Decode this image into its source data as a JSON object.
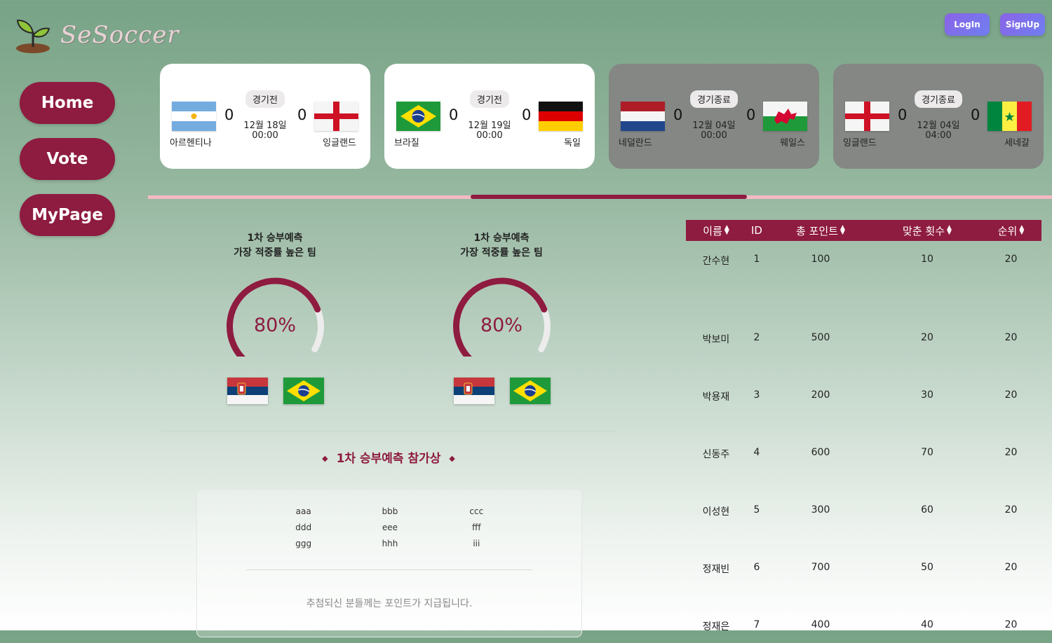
{
  "header": {
    "logo_text": "SeSoccer",
    "login_label": "LogIn",
    "signup_label": "SignUp"
  },
  "nav": {
    "home": "Home",
    "vote": "Vote",
    "mypage": "MyPage"
  },
  "matches": [
    {
      "status": "경기전",
      "home_team": "아르헨티나",
      "away_team": "잉글랜드",
      "home_score": "0",
      "away_score": "0",
      "date": "12월 18일",
      "time": "00:00",
      "home_flag": "argentina-flag",
      "away_flag": "england-flag"
    },
    {
      "status": "경기전",
      "home_team": "브라질",
      "away_team": "독일",
      "home_score": "0",
      "away_score": "0",
      "date": "12월 19일",
      "time": "00:00",
      "home_flag": "brazil-flag",
      "away_flag": "germany-flag"
    },
    {
      "status": "경기종료",
      "home_team": "네덜란드",
      "away_team": "웨일스",
      "home_score": "0",
      "away_score": "0",
      "date": "12월 04일",
      "time": "00:00",
      "home_flag": "netherlands-flag",
      "away_flag": "wales-flag"
    },
    {
      "status": "경기종료",
      "home_team": "잉글랜드",
      "away_team": "세네갈",
      "home_score": "0",
      "away_score": "0",
      "date": "12월 04일",
      "time": "04:00",
      "home_flag": "england-flag",
      "away_flag": "senegal-flag"
    }
  ],
  "predictions": [
    {
      "title_line1": "1차 승부예측",
      "title_line2": "가장 적중률 높은 팀",
      "percent_text": "80%",
      "percent_value": 0.8,
      "flags": [
        "serbia-flag",
        "brazil-flag"
      ]
    },
    {
      "title_line1": "1차 승부예측",
      "title_line2": "가장 적중률 높은 팀",
      "percent_text": "80%",
      "percent_value": 0.8,
      "flags": [
        "serbia-flag",
        "brazil-flag"
      ]
    }
  ],
  "winners": {
    "title": "1차 승부예측 참가상",
    "names": [
      "aaa",
      "bbb",
      "ccc",
      "ddd",
      "eee",
      "fff",
      "ggg",
      "hhh",
      "iii"
    ],
    "note": "추첨되신 분들께는 포인트가 지급됩니다."
  },
  "ranking": {
    "headers": [
      "이름",
      "ID",
      "총 포인트",
      "맞춘 횟수",
      "순위"
    ],
    "rows": [
      [
        "간수현",
        "1",
        "100",
        "10",
        "20"
      ],
      [
        "박보미",
        "2",
        "500",
        "20",
        "20"
      ],
      [
        "박용재",
        "3",
        "200",
        "30",
        "20"
      ],
      [
        "신동주",
        "4",
        "600",
        "70",
        "20"
      ],
      [
        "이성현",
        "5",
        "300",
        "60",
        "20"
      ],
      [
        "정재빈",
        "6",
        "700",
        "50",
        "20"
      ],
      [
        "정재은",
        "7",
        "400",
        "40",
        "20"
      ]
    ]
  },
  "colors": {
    "accent": "#8e1b40",
    "slider_track": "#f4b9c4",
    "ended_card": "#848784"
  }
}
